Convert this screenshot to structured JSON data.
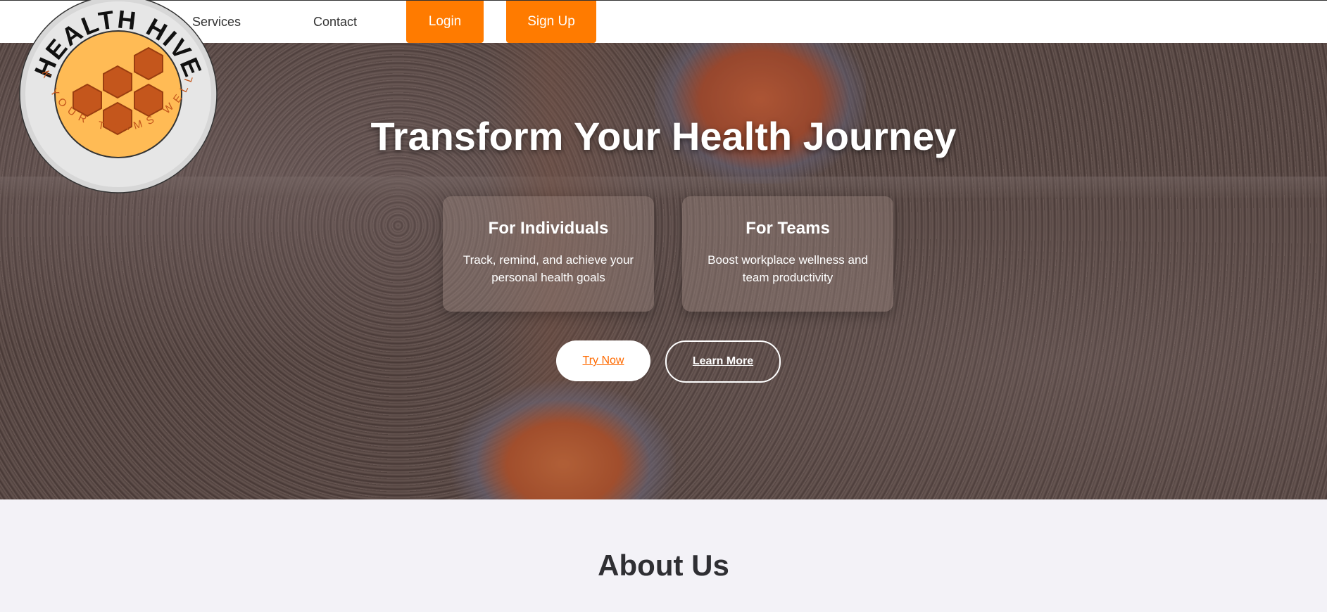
{
  "logo": {
    "title": "HEALTH HIVE",
    "tagline": "TRACK YOUR TEAMS WELLNESS"
  },
  "nav": {
    "links": [
      "Services",
      "Contact"
    ],
    "login_label": "Login",
    "signup_label": "Sign Up"
  },
  "hero": {
    "title": "Transform Your Health Journey",
    "cards": [
      {
        "title": "For Individuals",
        "text": "Track, remind, and achieve your personal health goals"
      },
      {
        "title": "For Teams",
        "text": "Boost workplace wellness and team productivity"
      }
    ],
    "try_now_label": "Try Now",
    "learn_more_label": "Learn More"
  },
  "about": {
    "title": "About Us"
  },
  "colors": {
    "accent": "#ff7b00",
    "logo_honey": "#ffbb55",
    "logo_hex": "#c4561c",
    "text_dark": "#2f2f33"
  }
}
